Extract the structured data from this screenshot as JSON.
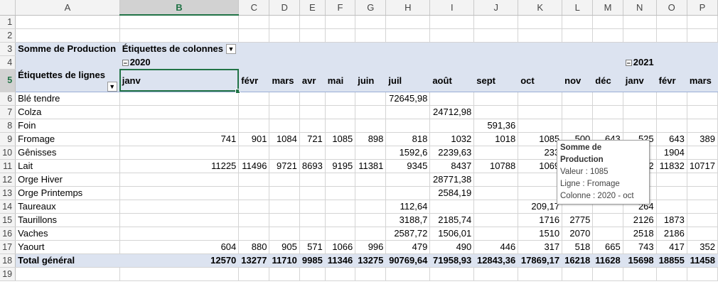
{
  "columns": [
    "",
    "A",
    "B",
    "C",
    "D",
    "E",
    "F",
    "G",
    "H",
    "I",
    "J",
    "K",
    "L",
    "M",
    "N",
    "O",
    "P"
  ],
  "rows": [
    "1",
    "2",
    "3",
    "4",
    "5",
    "6",
    "7",
    "8",
    "9",
    "10",
    "11",
    "12",
    "13",
    "14",
    "15",
    "16",
    "17",
    "18",
    "19"
  ],
  "pivot": {
    "value_label": "Somme de Production",
    "col_labels_title": "Étiquettes de colonnes",
    "row_labels_title": "Étiquettes de lignes",
    "year_2020": "2020",
    "year_2021": "2021",
    "months": [
      "janv",
      "févr",
      "mars",
      "avr",
      "mai",
      "juin",
      "juil",
      "août",
      "sept",
      "oct",
      "nov",
      "déc",
      "janv",
      "févr",
      "mars"
    ],
    "data": [
      {
        "label": "Blé tendre",
        "values": [
          "",
          "",
          "",
          "",
          "",
          "",
          "72645,98",
          "",
          "",
          "",
          "",
          "",
          "",
          "",
          ""
        ]
      },
      {
        "label": "Colza",
        "values": [
          "",
          "",
          "",
          "",
          "",
          "",
          "",
          "24712,98",
          "",
          "",
          "",
          "",
          "",
          "",
          ""
        ]
      },
      {
        "label": "Foin",
        "values": [
          "",
          "",
          "",
          "",
          "",
          "",
          "",
          "",
          "591,36",
          "",
          "",
          "",
          "",
          "",
          ""
        ]
      },
      {
        "label": "Fromage",
        "values": [
          "741",
          "901",
          "1084",
          "721",
          "1085",
          "898",
          "818",
          "1032",
          "1018",
          "1085",
          "500",
          "643",
          "525",
          "643",
          "389"
        ]
      },
      {
        "label": "Gênisses",
        "values": [
          "",
          "",
          "",
          "",
          "",
          "",
          "1592,6",
          "2239,63",
          "",
          "233",
          "",
          "",
          "",
          "1904",
          ""
        ]
      },
      {
        "label": "Lait",
        "values": [
          "11225",
          "11496",
          "9721",
          "8693",
          "9195",
          "11381",
          "9345",
          "8437",
          "10788",
          "1069",
          "",
          "",
          "22",
          "11832",
          "10717"
        ]
      },
      {
        "label": "Orge Hiver",
        "values": [
          "",
          "",
          "",
          "",
          "",
          "",
          "",
          "28771,38",
          "",
          "",
          "",
          "",
          "",
          "",
          ""
        ]
      },
      {
        "label": "Orge Printemps",
        "values": [
          "",
          "",
          "",
          "",
          "",
          "",
          "",
          "2584,19",
          "",
          "",
          "",
          "",
          "",
          "",
          ""
        ]
      },
      {
        "label": "Taureaux",
        "values": [
          "",
          "",
          "",
          "",
          "",
          "",
          "112,64",
          "",
          "",
          "209,17",
          "",
          "",
          "264",
          "",
          ""
        ]
      },
      {
        "label": "Taurillons",
        "values": [
          "",
          "",
          "",
          "",
          "",
          "",
          "3188,7",
          "2185,74",
          "",
          "1716",
          "2775",
          "",
          "2126",
          "1873",
          ""
        ]
      },
      {
        "label": "Vaches",
        "values": [
          "",
          "",
          "",
          "",
          "",
          "",
          "2587,72",
          "1506,01",
          "",
          "1510",
          "2070",
          "",
          "2518",
          "2186",
          ""
        ]
      },
      {
        "label": "Yaourt",
        "values": [
          "604",
          "880",
          "905",
          "571",
          "1066",
          "996",
          "479",
          "490",
          "446",
          "317",
          "518",
          "665",
          "743",
          "417",
          "352"
        ]
      }
    ],
    "total": {
      "label": "Total général",
      "values": [
        "12570",
        "13277",
        "11710",
        "9985",
        "11346",
        "13275",
        "90769,64",
        "71958,93",
        "12843,36",
        "17869,17",
        "16218",
        "11628",
        "15698",
        "18855",
        "11458"
      ]
    }
  },
  "tooltip": {
    "title": "Somme de Production",
    "valeur": "Valeur : 1085",
    "ligne": "Ligne : Fromage",
    "colonne": "Colonne : 2020 - oct"
  },
  "icons": {
    "dropdown": "filter-dropdown-icon",
    "collapse": "collapse-minus-icon"
  }
}
